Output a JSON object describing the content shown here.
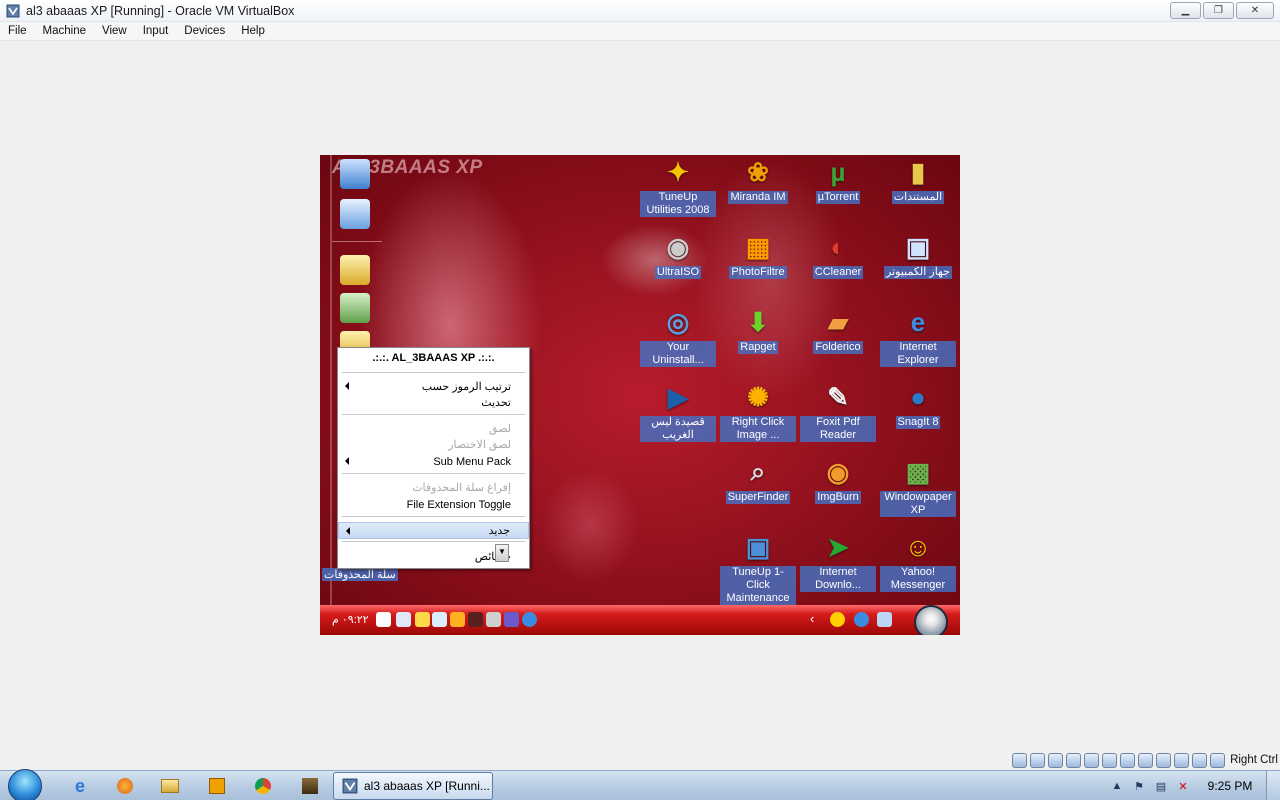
{
  "window": {
    "title": "al3 abaaas XP [Running] - Oracle VM VirtualBox",
    "min_glyph": "▁",
    "max_glyph": "❐",
    "close_glyph": "✕"
  },
  "menu": [
    "File",
    "Machine",
    "View",
    "Input",
    "Devices",
    "Help"
  ],
  "guest": {
    "watermark": "AL_3BAAAS XP",
    "desktop_icons": [
      {
        "label": "TuneUp Utilities 2008",
        "icon": "tuneup-utilities-icon",
        "glyph": "✦",
        "color": "#f5c400"
      },
      {
        "label": "Miranda IM",
        "icon": "miranda-im-icon",
        "glyph": "❀",
        "color": "#f0a000"
      },
      {
        "label": "µTorrent",
        "icon": "utorrent-icon",
        "glyph": "µ",
        "color": "#3aa33a"
      },
      {
        "label": "المستندات",
        "icon": "documents-folder-icon",
        "glyph": "▮",
        "color": "#e8c84a"
      },
      {
        "label": "UltraISO",
        "icon": "ultraiso-icon",
        "glyph": "◉",
        "color": "#cccccc"
      },
      {
        "label": "PhotoFiltre",
        "icon": "photofiltre-icon",
        "glyph": "▦",
        "color": "#ff9900"
      },
      {
        "label": "CCleaner",
        "icon": "ccleaner-icon",
        "glyph": "◐",
        "color": "#e23a2a"
      },
      {
        "label": "جهاز الكمبيوتر",
        "icon": "my-computer-icon",
        "glyph": "▣",
        "color": "#cfe3ff"
      },
      {
        "label": "Your Uninstall...",
        "icon": "your-uninstaller-icon",
        "glyph": "◎",
        "color": "#5aa0e0"
      },
      {
        "label": "Rapget",
        "icon": "rapget-icon",
        "glyph": "⬇",
        "color": "#6ed12a"
      },
      {
        "label": "Folderico",
        "icon": "folderico-icon",
        "glyph": "▰",
        "color": "#f0a040"
      },
      {
        "label": "Internet Explorer",
        "icon": "internet-explorer-icon",
        "glyph": "e",
        "color": "#3d8be0"
      },
      {
        "label": "قصيدة ليس الغريب",
        "icon": "real-player-icon",
        "glyph": "▶",
        "color": "#1d5fa8"
      },
      {
        "label": "Right Click Image ...",
        "icon": "right-click-image-icon",
        "glyph": "✺",
        "color": "#ffb300"
      },
      {
        "label": "Foxit Pdf Reader",
        "icon": "foxit-reader-icon",
        "glyph": "✎",
        "color": "#f0f0f0"
      },
      {
        "label": "SnagIt 8",
        "icon": "snagit-icon",
        "glyph": "●",
        "color": "#2a78c8"
      },
      {
        "label": "SuperFinder",
        "icon": "superfinder-icon",
        "glyph": "⌕",
        "color": "#d9d9d9"
      },
      {
        "label": "ImgBurn",
        "icon": "imgburn-icon",
        "glyph": "◉",
        "color": "#f39a2c"
      },
      {
        "label": "Windowpaper XP",
        "icon": "windowpaper-xp-icon",
        "glyph": "▩",
        "color": "#6ab04c"
      },
      {
        "label": "TuneUp 1-Click Maintenance",
        "icon": "tuneup-1-click-icon",
        "glyph": "▣",
        "color": "#4a8fd8"
      },
      {
        "label": "Internet Downlo...",
        "icon": "internet-download-manager-icon",
        "glyph": "➤",
        "color": "#22aa33"
      },
      {
        "label": "Yahoo! Messenger",
        "icon": "yahoo-messenger-icon",
        "glyph": "☺",
        "color": "#f5d000"
      }
    ],
    "recycle_bin_label": "سلة المحذوفات",
    "context_menu": {
      "header": ".:.:.  AL_3BAAAS XP  .:.:.",
      "items": [
        {
          "label": "ترتيب الرموز حسب",
          "submenu": true,
          "disabled": false,
          "highlight": false
        },
        {
          "label": "تحديث",
          "submenu": false,
          "disabled": false,
          "highlight": false
        },
        {
          "label": "لصق",
          "submenu": false,
          "disabled": true,
          "highlight": false
        },
        {
          "label": "لصق الاختصار",
          "submenu": false,
          "disabled": true,
          "highlight": false
        },
        {
          "label": "Sub Menu Pack",
          "submenu": true,
          "disabled": false,
          "highlight": false
        },
        {
          "label": "إفراغ سلة المحذوفات",
          "submenu": false,
          "disabled": true,
          "highlight": false
        },
        {
          "label": "File Extension Toggle",
          "submenu": false,
          "disabled": false,
          "highlight": false
        },
        {
          "label": "جديد",
          "submenu": true,
          "disabled": false,
          "highlight": true
        },
        {
          "label": "خصائص",
          "submenu": false,
          "disabled": false,
          "highlight": false
        }
      ]
    },
    "taskbar": {
      "clock": "٠٩:٢٢ م",
      "chevron": "‹"
    }
  },
  "statusbar": {
    "right_ctrl": "Right Ctrl"
  },
  "host_taskbar": {
    "active_task": "al3 abaaas XP [Runni...",
    "tray_up_arrow": "▲",
    "clock": "9:25 PM"
  }
}
